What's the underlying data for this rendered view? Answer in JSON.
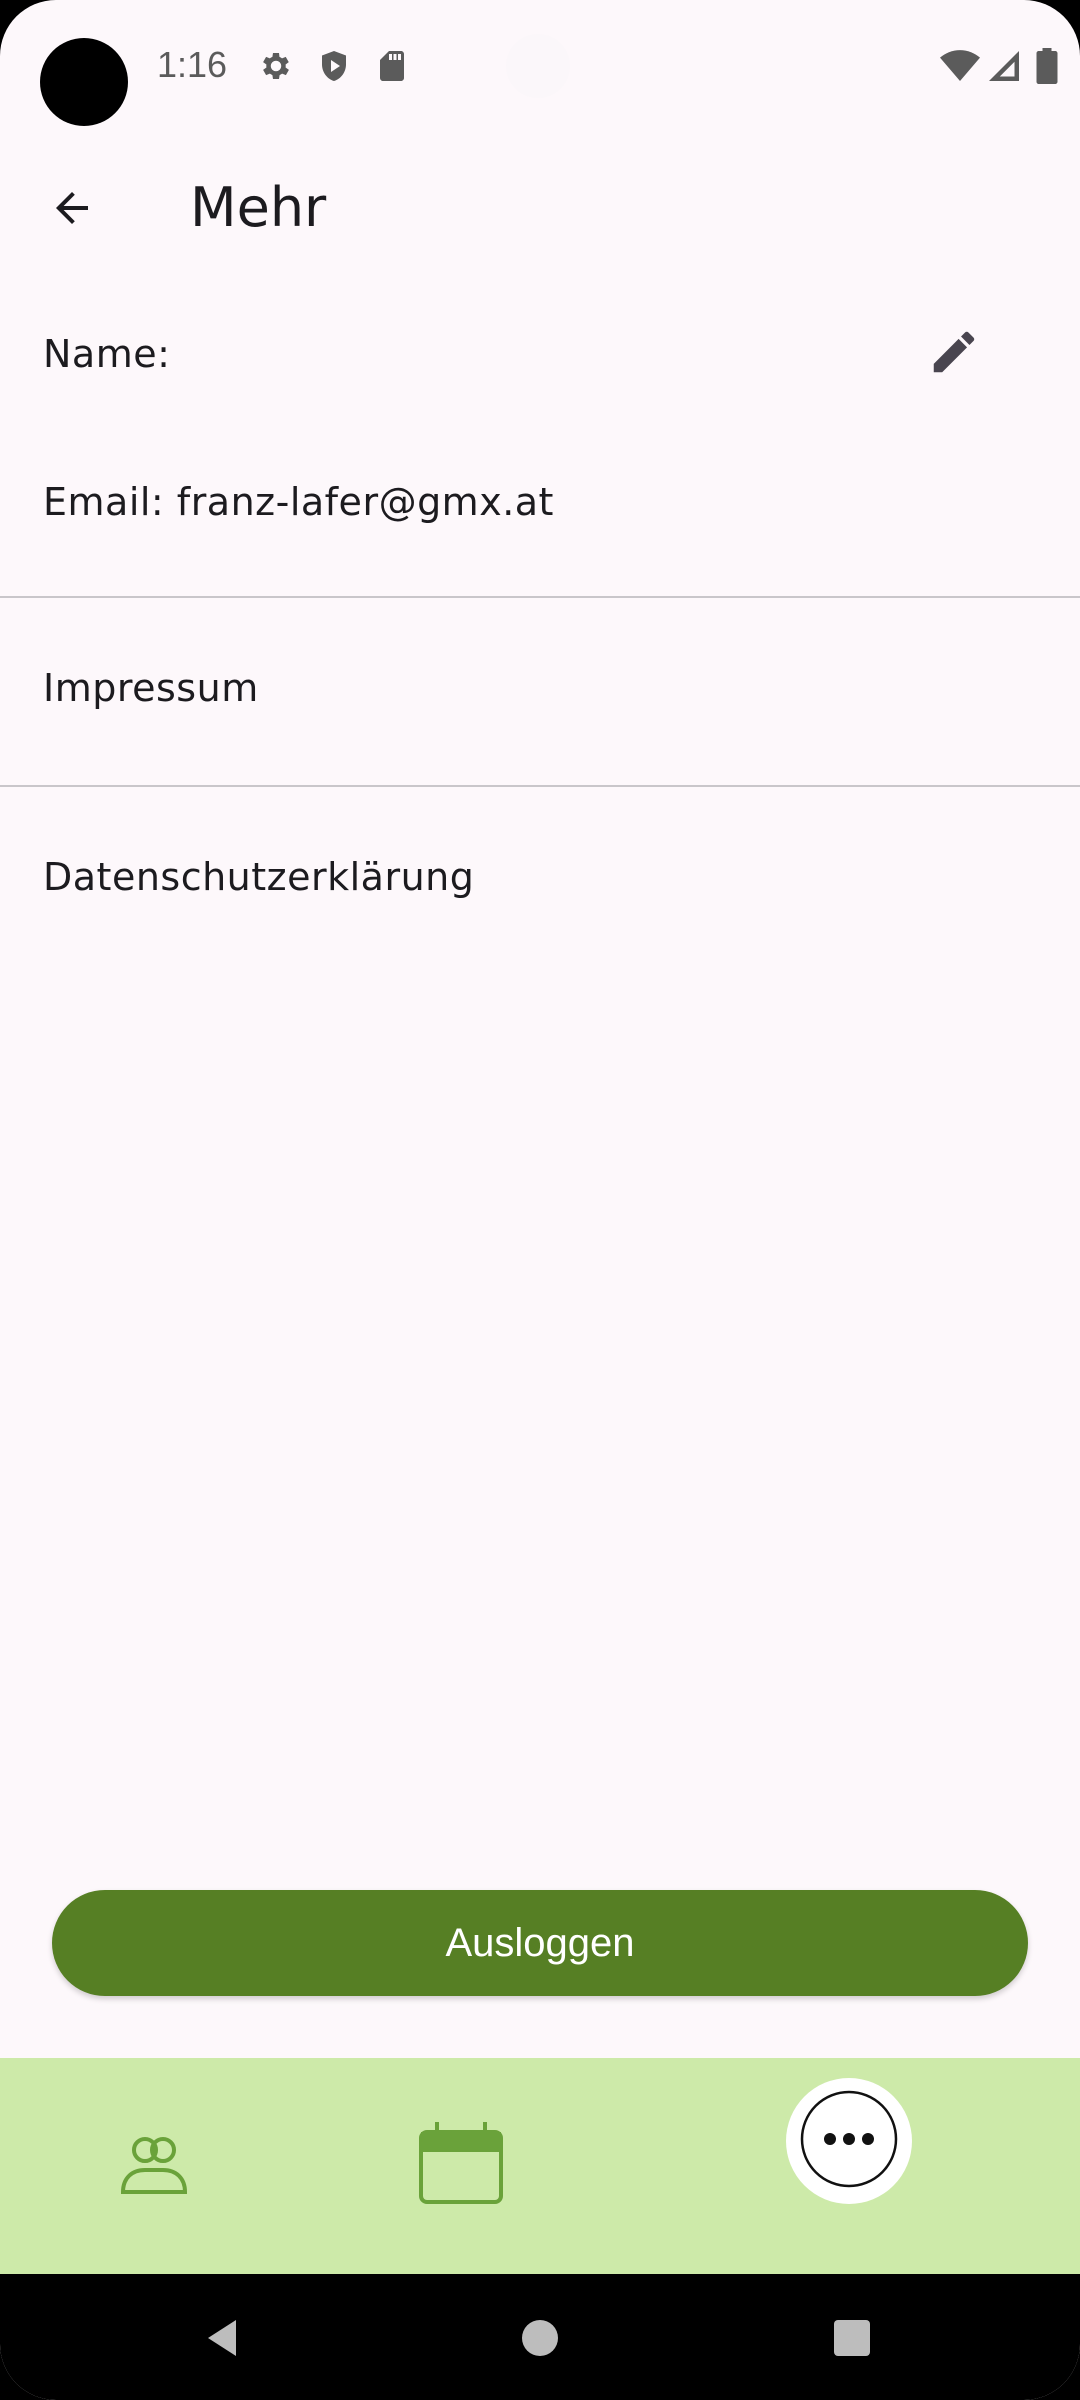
{
  "status_bar": {
    "time": "1:16",
    "icons": [
      "settings-icon",
      "shield-play-icon",
      "sd-card-icon",
      "wifi-icon",
      "signal-icon",
      "battery-icon"
    ]
  },
  "app_bar": {
    "title": "Mehr",
    "back_icon": "arrow-back-icon"
  },
  "profile": {
    "name_label": "Name:",
    "email_text": "Email: franz-lafer@gmx.at",
    "edit_icon": "pencil-icon"
  },
  "menu": {
    "impressum": "Impressum",
    "privacy": "Datenschutzerklärung"
  },
  "logout": {
    "label": "Ausloggen"
  },
  "bottom_nav": {
    "items": [
      {
        "icon": "group-icon",
        "selected": false
      },
      {
        "icon": "calendar-icon",
        "selected": false
      },
      {
        "icon": "more-icon",
        "selected": true
      }
    ]
  },
  "colors": {
    "primary": "#567f24",
    "nav_background": "#cdeaa9",
    "page_background": "#fdf8fb",
    "text": "#1c1b1f"
  }
}
